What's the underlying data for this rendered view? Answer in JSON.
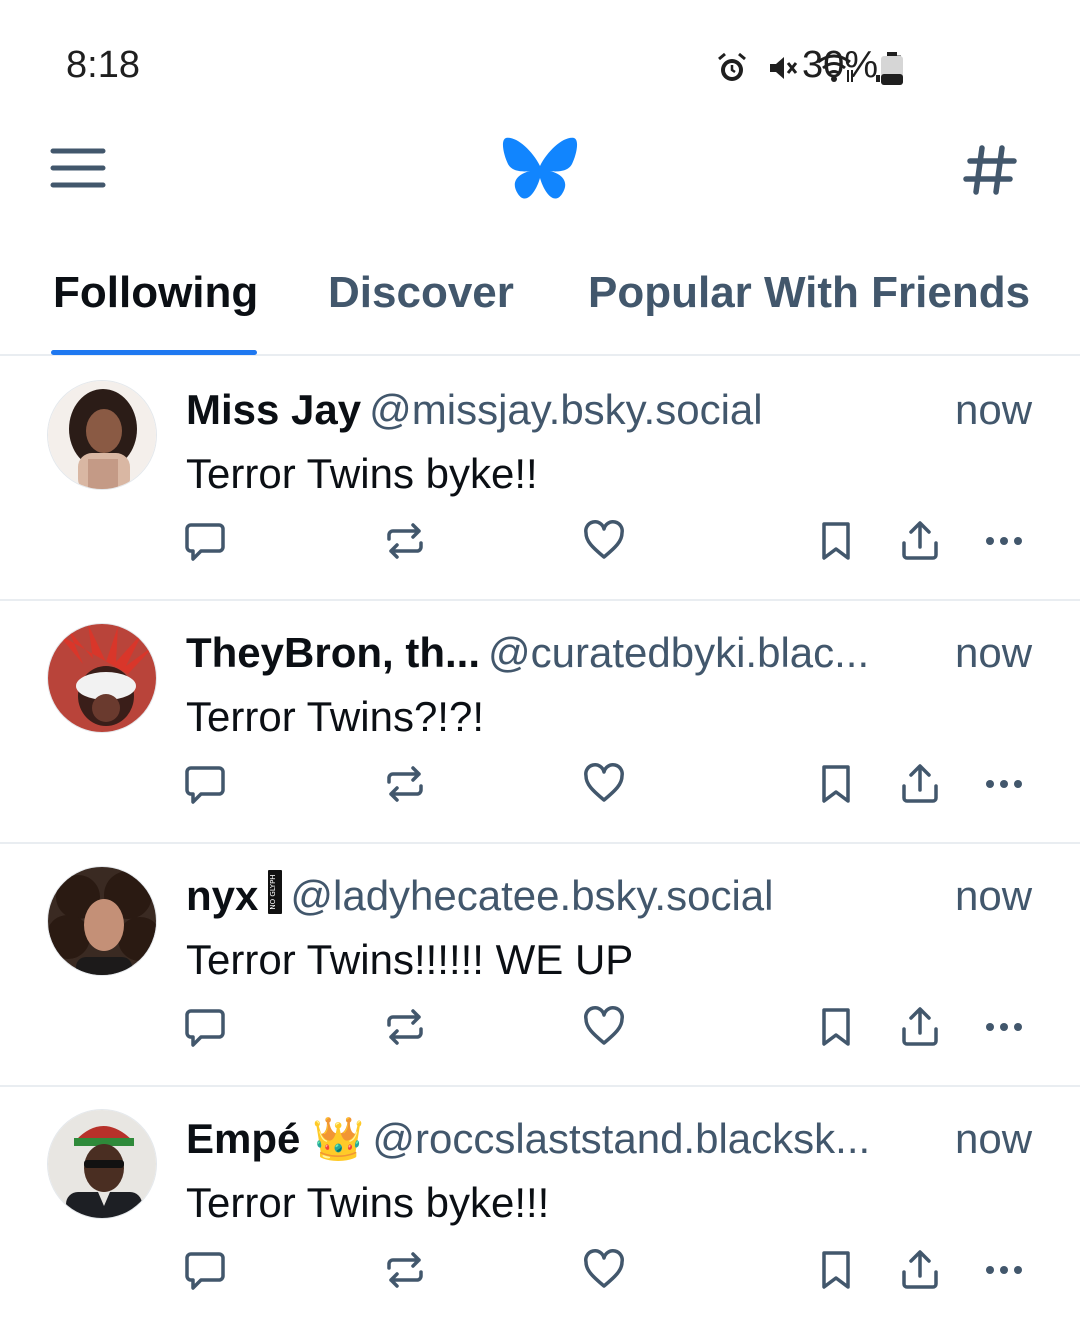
{
  "status_bar": {
    "time": "8:18",
    "battery": "30%",
    "icons": [
      "alarm-icon",
      "mute-icon",
      "wifi-icon",
      "signal-icon",
      "battery-icon"
    ]
  },
  "app_bar": {
    "menu_icon": "menu-icon",
    "logo": "butterfly-logo",
    "feeds_icon": "hash-icon",
    "accent_color": "#1185fe"
  },
  "tabs": [
    {
      "label": "Following",
      "active": true
    },
    {
      "label": "Discover",
      "active": false
    },
    {
      "label": "Popular With Friends",
      "active": false
    }
  ],
  "posts": [
    {
      "name": "Miss Jay",
      "handle": "@missjay.bsky.social",
      "time": "now",
      "text": "Terror Twins byke!!"
    },
    {
      "name": "TheyBron, th...",
      "handle": "@curatedbyki.blac...",
      "time": "now",
      "text": "Terror Twins?!?!"
    },
    {
      "name": "nyx",
      "handle": "@ladyhecatee.bsky.social",
      "time": "now",
      "text": "Terror Twins!!!!!! WE UP",
      "badge": "NO GLYPH"
    },
    {
      "name": "Empé 👑",
      "handle": "@roccslaststand.blacksk...",
      "time": "now",
      "text": "Terror Twins byke!!!"
    }
  ],
  "post_actions": [
    "reply-icon",
    "repost-icon",
    "like-icon",
    "bookmark-icon",
    "share-icon",
    "more-icon"
  ]
}
